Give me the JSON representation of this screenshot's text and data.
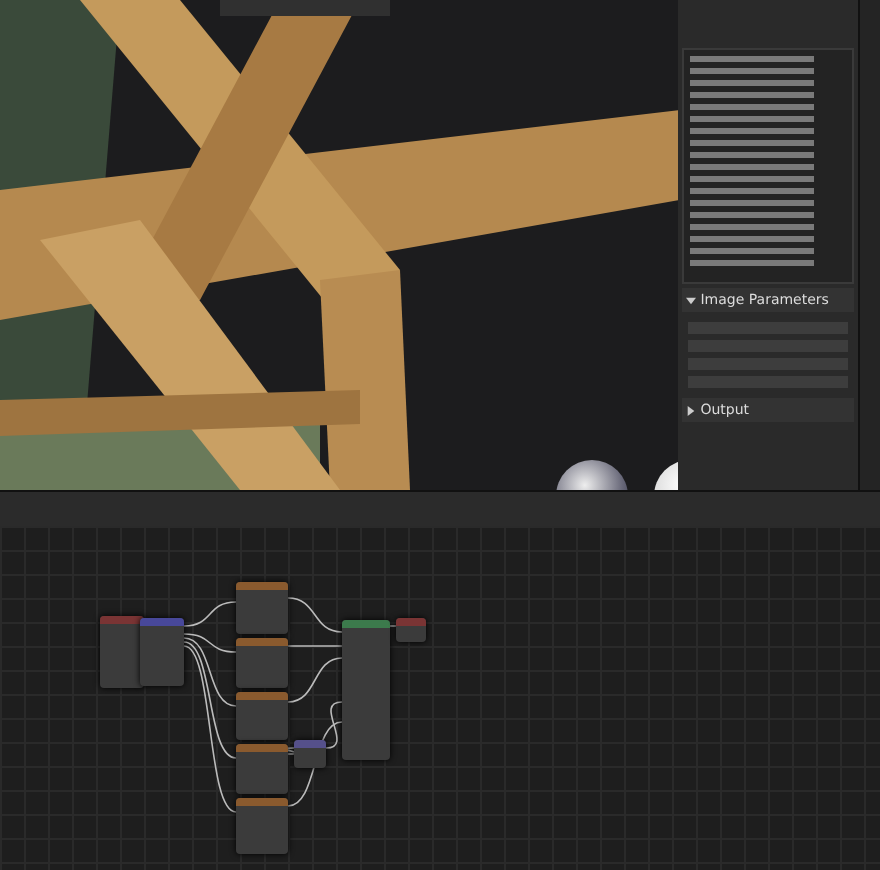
{
  "sidebar": {
    "sections": [
      {
        "title": "Image Parameters",
        "expanded": true
      },
      {
        "title": "Output",
        "expanded": false
      }
    ]
  },
  "nodes": [
    {
      "color": "#7a3434"
    },
    {
      "color": "#48489a"
    },
    {
      "color": "#8a5a2e"
    },
    {
      "color": "#8a5a2e"
    },
    {
      "color": "#8a5a2e"
    },
    {
      "color": "#8a5a2e"
    },
    {
      "color": "#8a5a2e"
    },
    {
      "color": "#55508a"
    },
    {
      "color": "#3c7a4c"
    },
    {
      "color": "#7a3434"
    }
  ]
}
